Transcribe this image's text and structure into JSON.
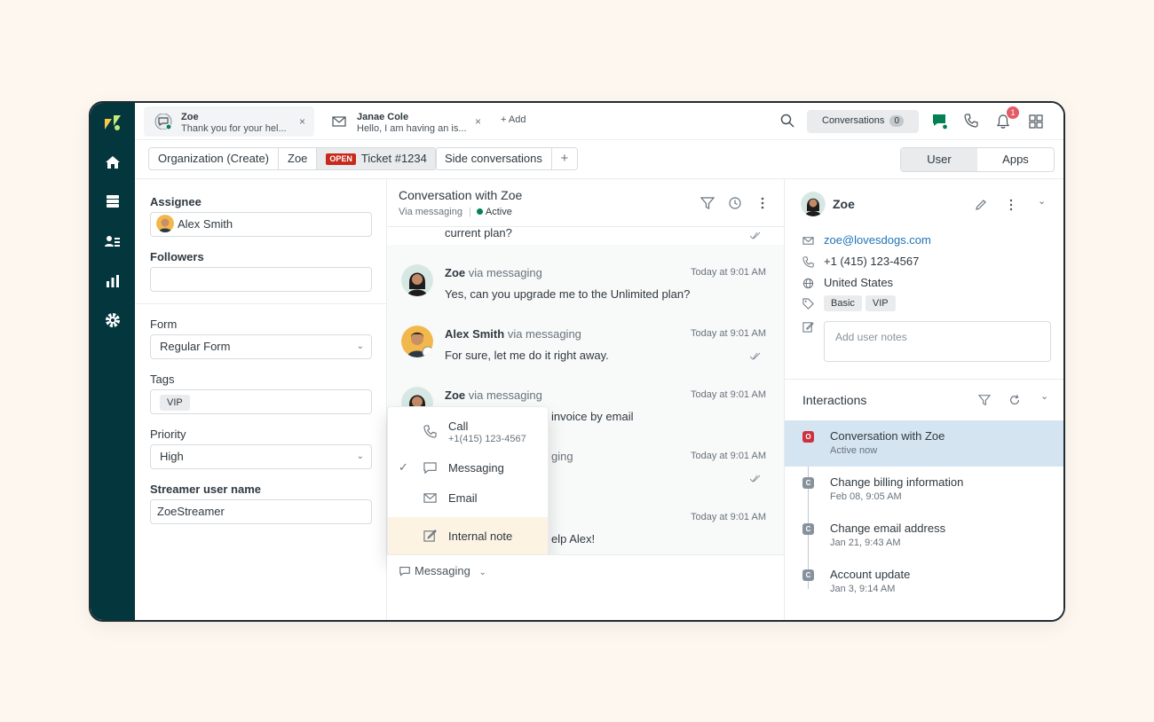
{
  "tabs": [
    {
      "name": "Zoe",
      "preview": "Thank you for your hel...",
      "close": "×"
    },
    {
      "name": "Janae Cole",
      "preview": "Hello, I am having an is...",
      "close": "×"
    }
  ],
  "topbar": {
    "add_tab": "+ Add",
    "conversations_label": "Conversations",
    "conversations_count": "0",
    "notification_count": "1"
  },
  "breadcrumbs": {
    "organization": "Organization (Create)",
    "user": "Zoe",
    "status_badge": "OPEN",
    "ticket": "Ticket #1234",
    "side_conversations": "Side conversations",
    "add": "+"
  },
  "context_tabs": {
    "user": "User",
    "apps": "Apps"
  },
  "ticket_fields": {
    "assignee_label": "Assignee",
    "assignee_value": "Alex Smith",
    "followers_label": "Followers",
    "form_label": "Form",
    "form_value": "Regular Form",
    "tags_label": "Tags",
    "tags": [
      "VIP"
    ],
    "priority_label": "Priority",
    "priority_value": "High",
    "streamer_label": "Streamer user name",
    "streamer_value": "ZoeStreamer"
  },
  "conversation": {
    "title": "Conversation with Zoe",
    "channel": "Via messaging",
    "status": "Active",
    "partial_message": "current plan?",
    "messages": [
      {
        "author": "Zoe",
        "via": "via messaging",
        "time": "Today at 9:01 AM",
        "text": "Yes, can you upgrade me to the Unlimited plan?"
      },
      {
        "author": "Alex Smith",
        "via": "via messaging",
        "time": "Today at 9:01 AM",
        "text": "For sure, let me do it right away."
      },
      {
        "author": "Zoe",
        "via": "via messaging",
        "time": "Today at 9:01 AM",
        "text": "invoice by email"
      },
      {
        "author": "",
        "via": "ging",
        "time": "Today at 9:01 AM",
        "text": ""
      },
      {
        "author": "",
        "via": "",
        "time": "Today at 9:01 AM",
        "text": "elp Alex!"
      }
    ]
  },
  "channel_menu": {
    "items": [
      {
        "label": "Call",
        "sub": "+1(415) 123-4567",
        "icon": "phone-icon"
      },
      {
        "label": "Messaging",
        "sub": "",
        "icon": "chat-icon",
        "checked": true
      },
      {
        "label": "Email",
        "sub": "",
        "icon": "email-icon"
      },
      {
        "label": "Internal note",
        "sub": "",
        "icon": "note-icon"
      }
    ]
  },
  "composer": {
    "channel": "Messaging"
  },
  "user_profile": {
    "name": "Zoe",
    "email": "zoe@lovesdogs.com",
    "phone": "+1 (415) 123-4567",
    "country": "United States",
    "tags": [
      "Basic",
      "VIP"
    ],
    "notes_placeholder": "Add user notes"
  },
  "interactions": {
    "title": "Interactions",
    "items": [
      {
        "badge": "O",
        "title": "Conversation with Zoe",
        "date": "Active now"
      },
      {
        "badge": "C",
        "title": "Change billing information",
        "date": "Feb 08, 9:05 AM"
      },
      {
        "badge": "C",
        "title": "Change email address",
        "date": "Jan 21, 9:43 AM"
      },
      {
        "badge": "C",
        "title": "Account update",
        "date": "Jan 3, 9:14 AM"
      }
    ]
  },
  "colors": {
    "nav_bg": "#03363d",
    "accent_green": "#038153",
    "open_red": "#c72a1c",
    "selected_row": "#d4e4f0",
    "internal_note_bg": "#fcf3e3"
  }
}
